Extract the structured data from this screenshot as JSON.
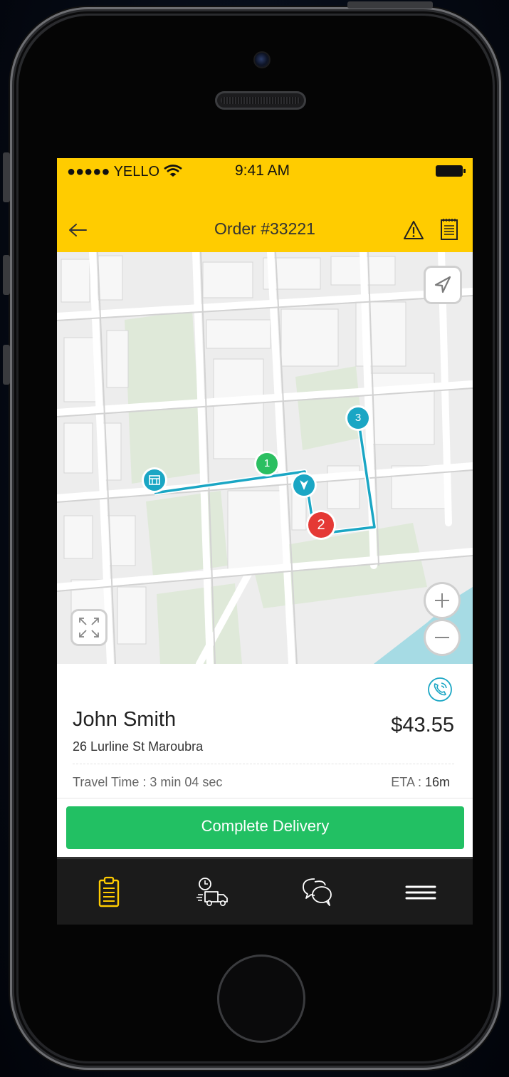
{
  "status_bar": {
    "carrier": "●●●●● YELLO",
    "time": "9:41 AM"
  },
  "header": {
    "title": "Order #33221",
    "back_icon": "arrow-left-icon",
    "warning_icon": "warning-triangle-icon",
    "notes_icon": "notepad-icon",
    "background": "#ffcc00"
  },
  "map": {
    "markers": [
      {
        "label": "1",
        "color": "#2bbf61"
      },
      {
        "label": "2",
        "color": "#e53935"
      },
      {
        "label": "3",
        "color": "#1aa6c4"
      }
    ],
    "route_color": "#1aa6c4",
    "controls": [
      "navigation-arrow-icon",
      "zoom-in-icon",
      "zoom-out-icon",
      "expand-icon"
    ]
  },
  "order": {
    "customer_name": "John Smith",
    "address": "26 Lurline St Maroubra",
    "price": "$43.55",
    "travel_time": "Travel Time : 3 min 04 sec",
    "eta_label": "ETA : ",
    "eta_value": "16m",
    "call_icon": "phone-call-icon"
  },
  "actions": {
    "complete_label": "Complete Delivery",
    "complete_color": "#22c063"
  },
  "tabbar": {
    "items": [
      {
        "icon": "clipboard-icon",
        "active": true
      },
      {
        "icon": "delivery-truck-clock-icon",
        "active": false
      },
      {
        "icon": "chat-bubbles-icon",
        "active": false
      },
      {
        "icon": "hamburger-menu-icon",
        "active": false
      }
    ],
    "active_color": "#ffcc00"
  }
}
